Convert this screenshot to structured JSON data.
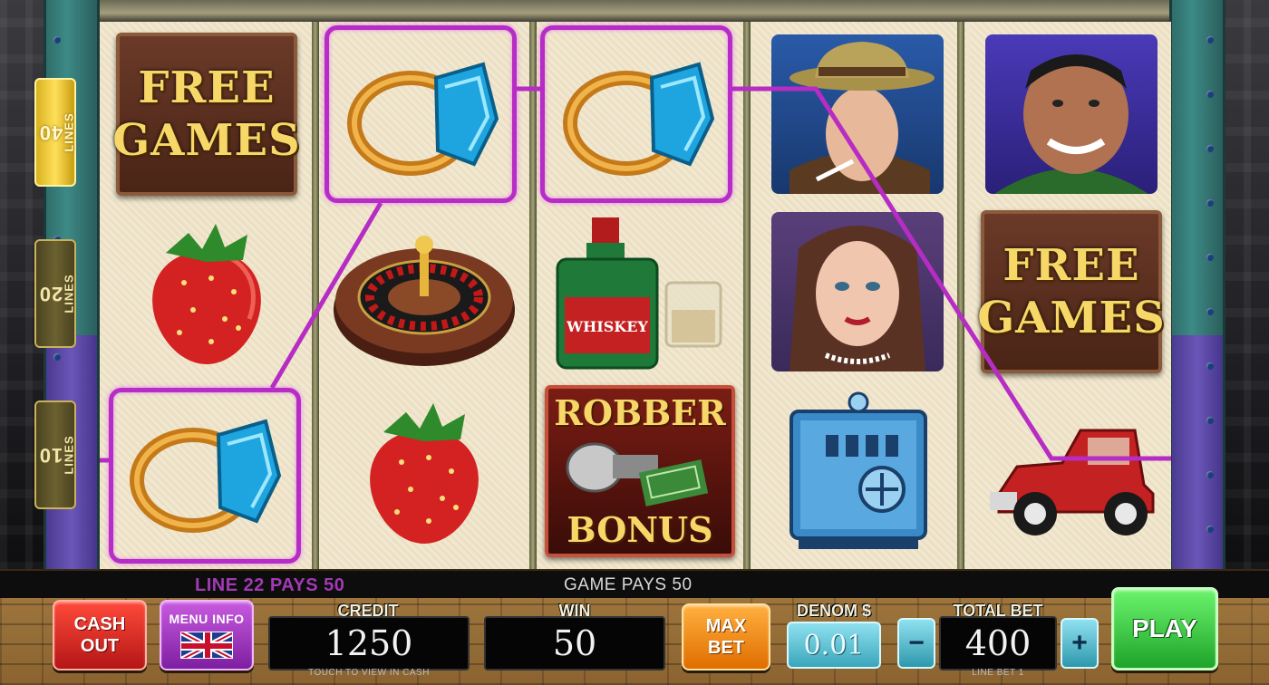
{
  "lines": {
    "forty": {
      "number": "40",
      "label": "LINES"
    },
    "twenty": {
      "number": "20",
      "label": "LINES"
    },
    "ten": {
      "number": "10",
      "label": "LINES"
    }
  },
  "symbols": {
    "free_games_line1": "FREE",
    "free_games_line2": "GAMES",
    "robber_top": "ROBBER",
    "robber_bottom": "BONUS",
    "whiskey_label": "WHISKEY"
  },
  "messages": {
    "line_pays": "LINE 22 PAYS 50",
    "game_pays": "GAME PAYS 50"
  },
  "controls": {
    "cash_out_line1": "CASH",
    "cash_out_line2": "OUT",
    "menu_info": "MENU INFO",
    "credit_label": "CREDIT",
    "credit_value": "1250",
    "credit_hint": "TOUCH TO VIEW IN CASH",
    "win_label": "WIN",
    "win_value": "50",
    "max_bet_line1": "MAX",
    "max_bet_line2": "BET",
    "denom_label": "DENOM $",
    "denom_value": "0.01",
    "minus": "−",
    "plus": "+",
    "total_bet_label": "TOTAL BET",
    "total_bet_value": "400",
    "line_bet_hint": "LINE BET 1",
    "play": "PLAY"
  },
  "colors": {
    "win_line": "#b62cc4",
    "cash_out": "#d22a1f",
    "menu": "#a13ab3",
    "max_bet": "#f08a10",
    "play": "#2dbb35",
    "denom": "#5cc3d6"
  }
}
